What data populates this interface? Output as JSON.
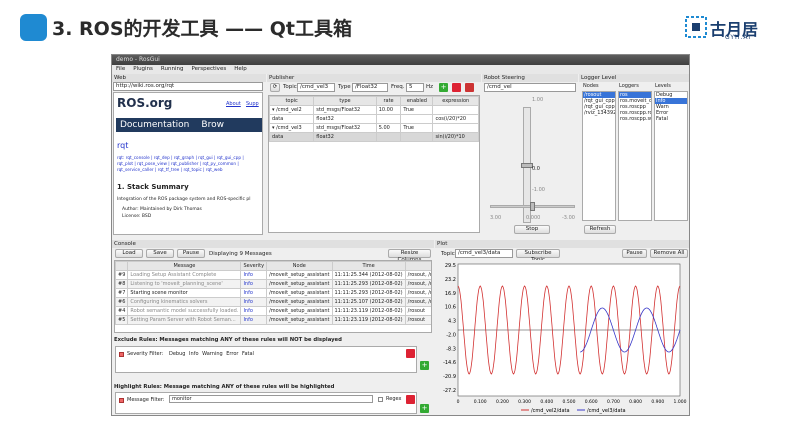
{
  "slide": {
    "title": "3. ROS的开发工具 —— Qt工具箱",
    "brand_name": "古月居",
    "brand_sub": "GYH.AI"
  },
  "window": {
    "title": "demo - RosGui",
    "menu": [
      "File",
      "Plugins",
      "Running",
      "Perspectives",
      "Help"
    ]
  },
  "web": {
    "header": "Web",
    "url": "http://wiki.ros.org/rqt",
    "logo_text": "ROS.org",
    "links": [
      "About",
      "Supp"
    ],
    "banner": [
      "Documentation",
      "Brow"
    ],
    "page_title": "rqt",
    "pkg_line1": "rqt: rqt_console | rqt_dep | rqt_graph | rqt_gui | rqt_gui_cpp |",
    "pkg_line2": "rqt_plot | rqt_pose_view | rqt_publisher | rqt_py_common |",
    "pkg_line3": "rqt_service_caller | rqt_tf_tree | rqt_topic | rqt_web",
    "section": "1. Stack Summary",
    "desc": "Integration of the ROS package system and ROS-specific pl",
    "bullets": [
      "Author: Maintained by Dirk Thomas",
      "License: BSD"
    ]
  },
  "publisher": {
    "header": "Publisher",
    "topic_label": "Topic",
    "topic_value": "/cmd_vel3",
    "type_label": "Type",
    "type_value": "/Float32",
    "freq_label": "Freq.",
    "freq_value": "5",
    "hz": "Hz",
    "columns": [
      "topic",
      "type",
      "rate",
      "enabled",
      "expression"
    ],
    "rows": [
      [
        "▾ /cmd_vel2",
        "std_msgs/Float32",
        "10.00",
        "True",
        ""
      ],
      [
        "data",
        "float32",
        "",
        "",
        "cos(i/20)*20"
      ],
      [
        "▾ /cmd_vel3",
        "std_msgs/Float32",
        "5.00",
        "True",
        ""
      ],
      [
        "data",
        "float32",
        "",
        "",
        "sin(i/20)*10"
      ]
    ]
  },
  "steering": {
    "header": "Robot Steering",
    "topic": "/cmd_vel",
    "top_value": "1.00",
    "mid_value": "0.0",
    "bottom_value": "-1.00",
    "left_value": "3.00",
    "center_value": "0.000",
    "right_value": "-3.00",
    "stop": "Stop"
  },
  "logger": {
    "header": "Logger Level",
    "nodes_label": "Nodes",
    "loggers_label": "Loggers",
    "levels_label": "Levels",
    "nodes": [
      "/rosout",
      "/rqt_gui_cpp",
      "/rqt_gui_cpp",
      "/rviz_134392"
    ],
    "loggers": [
      "ros",
      "ros.moveit_co",
      "ros.roscpp",
      "ros.roscpp.ro",
      "ros.roscpp.su"
    ],
    "levels": [
      "Debug",
      "Info",
      "Warn",
      "Error",
      "Fatal"
    ],
    "refresh": "Refresh"
  },
  "console": {
    "header": "Console",
    "load": "Load",
    "save": "Save",
    "pause": "Pause",
    "displaying": "Displaying 9 Messages",
    "resize": "Resize Columns",
    "columns": [
      "",
      "Message",
      "Severity",
      "Node",
      "Time",
      ""
    ],
    "rows": [
      [
        "#9",
        "Loading Setup Assistant Complete",
        "Info",
        "/moveit_setup_assistant",
        "11:11:25.344 (2012-08-02)",
        "/rosout, /move"
      ],
      [
        "#8",
        "Listening to 'moveit_planning_scene'",
        "Info",
        "/moveit_setup_assistant",
        "11:11:25.293 (2012-08-02)",
        "/rosout, /move"
      ],
      [
        "#7",
        "Starting scene monitor",
        "Info",
        "/moveit_setup_assistant",
        "11:11:25.293 (2012-08-02)",
        "/rosout, /move"
      ],
      [
        "#6",
        "Configuring kinematics solvers",
        "Info",
        "/moveit_setup_assistant",
        "11:11:25.107 (2012-08-02)",
        "/rosout, /move"
      ],
      [
        "#4",
        "Robot semantic model successfully loaded.",
        "Info",
        "/moveit_setup_assistant",
        "11:11:23.119 (2012-08-02)",
        "/rosout"
      ],
      [
        "#5",
        "Setting Param Server with Robot Seman...",
        "Info",
        "/moveit_setup_assistant",
        "11:11:23.119 (2012-08-02)",
        "/rosout"
      ]
    ],
    "exclude_title": "Exclude Rules: Messages matching ANY of these rules will NOT be displayed",
    "severity_filter": "Severity Filter:",
    "severities": [
      "Debug",
      "Info",
      "Warning",
      "Error",
      "Fatal"
    ],
    "highlight_title": "Highlight Rules: Message matching ANY of these rules will be highlighted",
    "message_filter": "Message Filter:",
    "message_value": "monitor",
    "regex": "Regex"
  },
  "plot": {
    "header": "Plot",
    "topic_label": "Topic",
    "topic_value": "/cmd_vel3/data",
    "subscribe": "Subscribe Topic",
    "pause": "Pause",
    "remove_all": "Remove All",
    "legend": [
      "/cmd_vel2/data",
      "/cmd_vel3/data"
    ],
    "colors": [
      "#d23030",
      "#3838c8"
    ]
  },
  "chart_data": {
    "type": "line",
    "x": [
      0,
      0.1,
      0.2,
      0.3,
      0.4,
      0.5,
      0.6,
      0.7,
      0.8,
      0.9,
      1.0
    ],
    "xticks": [
      "0",
      "0.100",
      "0.200",
      "0.300",
      "0.400",
      "0.500",
      "0.600",
      "0.700",
      "0.800",
      "0.900",
      "1.000"
    ],
    "yticks": [
      "29.5",
      "23.2",
      "16.9",
      "10.6",
      "4.3",
      "-2.0",
      "-8.3",
      "-14.6",
      "-20.9",
      "-27.2"
    ],
    "ylim": [
      -30,
      30
    ],
    "series": [
      {
        "name": "/cmd_vel2/data",
        "amplitude": 20,
        "cycles": 10,
        "start": 0
      },
      {
        "name": "/cmd_vel3/data",
        "amplitude": 10,
        "cycles": 5,
        "start": 0.55
      }
    ]
  }
}
